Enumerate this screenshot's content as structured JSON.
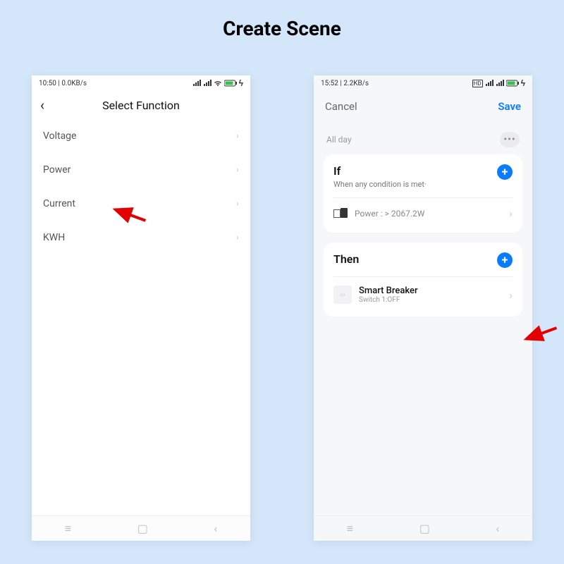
{
  "page_title": "Create Scene",
  "left_phone": {
    "status": {
      "time": "10:50",
      "net": "0.0KB/s"
    },
    "header": {
      "title": "Select Function",
      "back_icon": "‹"
    },
    "functions": [
      {
        "label": "Voltage"
      },
      {
        "label": "Power"
      },
      {
        "label": "Current"
      },
      {
        "label": "KWH"
      }
    ]
  },
  "right_phone": {
    "status": {
      "time": "15:52",
      "net": "2.2KB/s"
    },
    "header": {
      "cancel": "Cancel",
      "save": "Save"
    },
    "scene": {
      "all_day": "All day",
      "dots": "•••",
      "if": {
        "title": "If",
        "subtitle": "When any condition is met·",
        "condition": "Power : > 2067.2W"
      },
      "then": {
        "title": "Then",
        "action_name": "Smart Breaker",
        "action_sub": "Switch 1:OFF"
      }
    }
  },
  "nav": {
    "menu": "≡",
    "home": "▢",
    "back": "‹"
  },
  "chevron": "›",
  "plus": "+"
}
